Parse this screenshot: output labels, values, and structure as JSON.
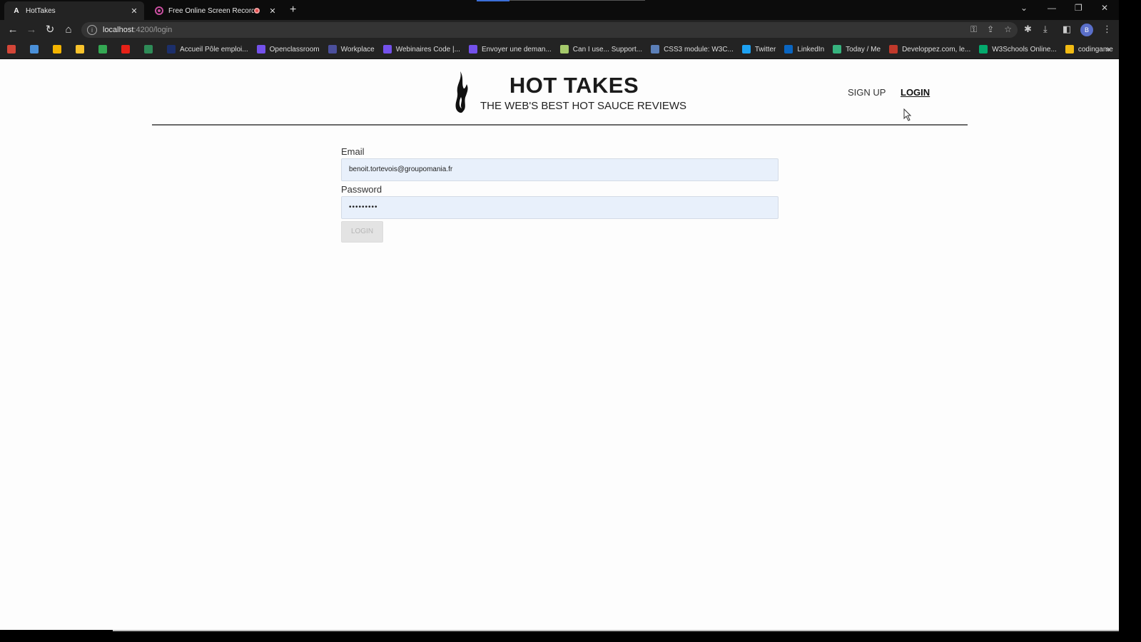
{
  "browser": {
    "tabs": [
      {
        "title": "HotTakes",
        "favicon": "A"
      },
      {
        "title": "Free Online Screen Recorder"
      }
    ],
    "address": {
      "host": "localhost",
      "path": ":4200/login"
    },
    "profile_initial": "B",
    "bookmarks": [
      {
        "label": "",
        "color": "#d44638"
      },
      {
        "label": "",
        "color": "#4a90d9"
      },
      {
        "label": "",
        "color": "#f4b400"
      },
      {
        "label": "",
        "color": "#f9c32c"
      },
      {
        "label": "",
        "color": "#34a853"
      },
      {
        "label": "",
        "color": "#e62117"
      },
      {
        "label": "",
        "color": "#2e8b57"
      },
      {
        "label": "Accueil Pôle emploi...",
        "color": "#1c2f6b"
      },
      {
        "label": "Openclassroom",
        "color": "#7451eb"
      },
      {
        "label": "Workplace",
        "color": "#4b4f9c"
      },
      {
        "label": "Webinaires Code |...",
        "color": "#7451eb"
      },
      {
        "label": "Envoyer une deman...",
        "color": "#7451eb"
      },
      {
        "label": "Can I use... Support...",
        "color": "#a5c96b"
      },
      {
        "label": "CSS3 module: W3C...",
        "color": "#5b7fb8"
      },
      {
        "label": "Twitter",
        "color": "#1da1f2"
      },
      {
        "label": "LinkedIn",
        "color": "#0a66c2"
      },
      {
        "label": "Today / Me",
        "color": "#36b37e"
      },
      {
        "label": "Developpez.com, le...",
        "color": "#c0392b"
      },
      {
        "label": "W3Schools Online...",
        "color": "#04aa6d"
      },
      {
        "label": "codingame",
        "color": "#f2bb13"
      }
    ]
  },
  "site": {
    "title": "HOT TAKES",
    "subtitle": "THE WEB'S BEST HOT SAUCE REVIEWS",
    "nav": {
      "signup": "SIGN UP",
      "login": "LOGIN"
    }
  },
  "form": {
    "email_label": "Email",
    "email_value": "benoit.tortevois@groupomania.fr",
    "password_label": "Password",
    "password_value": "•••••••••",
    "submit_label": "LOGIN"
  }
}
